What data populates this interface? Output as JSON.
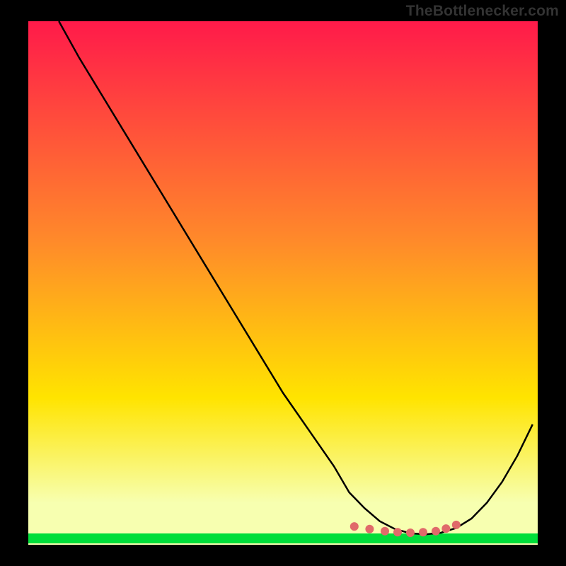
{
  "watermark": "TheBottlenecker.com",
  "chart_data": {
    "type": "line",
    "title": "",
    "xlabel": "",
    "ylabel": "",
    "xlim": [
      0,
      100
    ],
    "ylim": [
      0,
      100
    ],
    "background_gradient": {
      "top": "#ff1a4a",
      "mid": "#ffe400",
      "bottom_band": "#00de3a"
    },
    "series": [
      {
        "name": "curve",
        "color": "#000000",
        "x": [
          6,
          10,
          15,
          20,
          25,
          30,
          35,
          40,
          45,
          50,
          55,
          60,
          63,
          66,
          69,
          72,
          75,
          78,
          81,
          84,
          87,
          90,
          93,
          96,
          99
        ],
        "y": [
          100,
          93,
          85,
          77,
          69,
          61,
          53,
          45,
          37,
          29,
          22,
          15,
          10,
          7,
          4.5,
          3,
          2.2,
          2,
          2.3,
          3.2,
          5,
          8,
          12,
          17,
          23
        ]
      }
    ],
    "markers": {
      "name": "highlight-dots",
      "color": "#e06a6a",
      "radius": 6,
      "x": [
        64,
        67,
        70,
        72.5,
        75,
        77.5,
        80,
        82,
        84
      ],
      "y": [
        3.5,
        3.0,
        2.6,
        2.4,
        2.3,
        2.4,
        2.6,
        3.1,
        3.8
      ]
    }
  }
}
